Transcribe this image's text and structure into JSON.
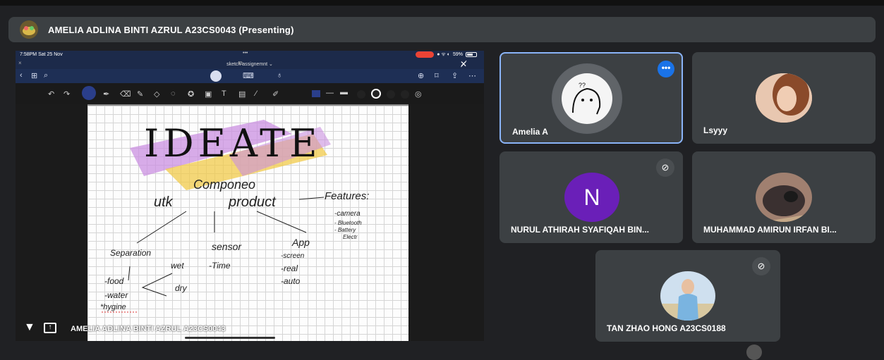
{
  "presenter": {
    "title": "AMELIA ADLINA BINTI AZRUL A23CS0043 (Presenting)"
  },
  "ipad": {
    "time": "7:58PM  Sat 25 Nov",
    "dots": "•••",
    "battery": "59%",
    "doc_title": "sketch assignemnt ⌄"
  },
  "share_footer": {
    "name": "AMELIA ADLINA BINTI AZRUL A23CS0043"
  },
  "sketch": {
    "title": "IDEATE",
    "components": "Componeo",
    "line2a": "utk",
    "line2b": "product",
    "features": "Features:",
    "feat_list": [
      "-camera",
      "- Bluetooth",
      "- Battery",
      "Electr"
    ],
    "separation": "Separation",
    "sensor": "sensor",
    "app": "App",
    "wet": "wet",
    "dry": "dry",
    "food": "-food",
    "water": "-water",
    "time": "-Time",
    "screen": "-screen",
    "real": "-real",
    "auto": "-auto",
    "hygiene": "*hygine"
  },
  "participants": [
    {
      "name": "Amelia A",
      "active": true
    },
    {
      "name": "Lsyyy"
    },
    {
      "name": "NURUL ATHIRAH SYAFIQAH BIN...",
      "initial": "N",
      "avatar_color": "#6a1fb8"
    },
    {
      "name": "MUHAMMAD AMIRUN IRFAN BI..."
    },
    {
      "name": "TAN ZHAO HONG A23CS0188"
    }
  ],
  "colors": {
    "accent": "#8ab4f8",
    "tile": "#3c4043",
    "background": "#202124",
    "more_button": "#1a73e8"
  }
}
